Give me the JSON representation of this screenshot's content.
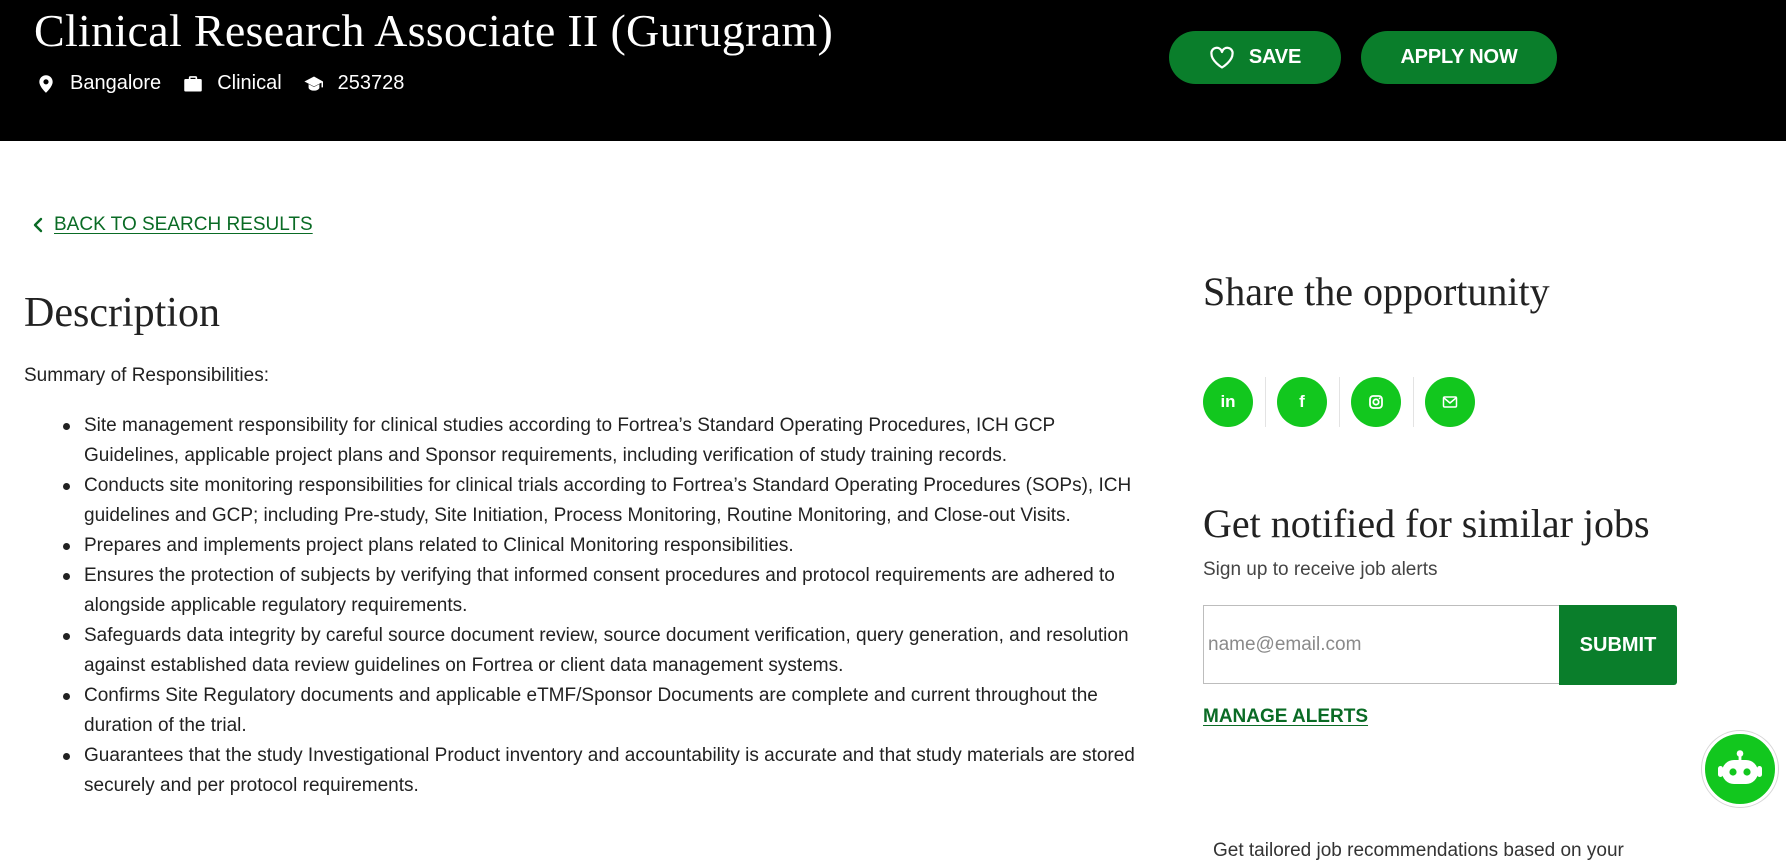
{
  "header": {
    "job_title": "Clinical Research Associate II (Gurugram)",
    "location": "Bangalore",
    "category": "Clinical",
    "job_id": "253728",
    "save_label": "SAVE",
    "apply_label": "APPLY NOW"
  },
  "nav": {
    "back_label": "BACK TO SEARCH RESULTS"
  },
  "description": {
    "heading": "Description",
    "summary_label": "Summary of Responsibilities:",
    "responsibilities": [
      "Site management responsibility for clinical studies according to Fortrea’s Standard Operating Procedures, ICH GCP Guidelines, applicable project plans and Sponsor requirements, including verification of study training records.",
      "Conducts site monitoring responsibilities for clinical trials according to Fortrea’s Standard Operating Procedures (SOPs), ICH guidelines and GCP; including Pre-study, Site Initiation, Process Monitoring, Routine Monitoring, and Close-out Visits.",
      "Prepares and implements project plans related to Clinical Monitoring responsibilities.",
      "Ensures the protection of subjects by verifying that informed consent procedures and protocol requirements are adhered to alongside applicable regulatory requirements.",
      "Safeguards data integrity by careful source document review, source document verification, query generation, and resolution against established data review guidelines on Fortrea or client data management systems.",
      "Confirms Site Regulatory documents and applicable eTMF/Sponsor Documents are complete and current throughout the duration of the trial.",
      "Guarantees that the study Investigational Product inventory and accountability is accurate and that study materials are stored securely and per protocol requirements."
    ]
  },
  "share": {
    "heading": "Share the opportunity",
    "linkedin_label": "in",
    "facebook_label": "f"
  },
  "alerts": {
    "heading": "Get notified for similar jobs",
    "subheading": "Sign up to receive job alerts",
    "email_placeholder": "name@email.com",
    "email_value": "",
    "submit_label": "SUBMIT",
    "manage_label": "MANAGE ALERTS"
  },
  "recommendations": {
    "teaser": "Get tailored job recommendations based on your"
  },
  "colors": {
    "header_bg": "#000000",
    "brand_green": "#0a7e2b",
    "link_green": "#0a6b25",
    "accent_green": "#12c71e"
  },
  "icons": {
    "location": "map-pin-icon",
    "category": "briefcase-icon",
    "job_id": "graduation-cap-icon",
    "save": "heart-icon",
    "back": "chevron-left-icon",
    "linkedin": "linkedin-icon",
    "facebook": "facebook-icon",
    "instagram": "instagram-icon",
    "email": "mail-icon",
    "chatbot": "robot-icon"
  }
}
